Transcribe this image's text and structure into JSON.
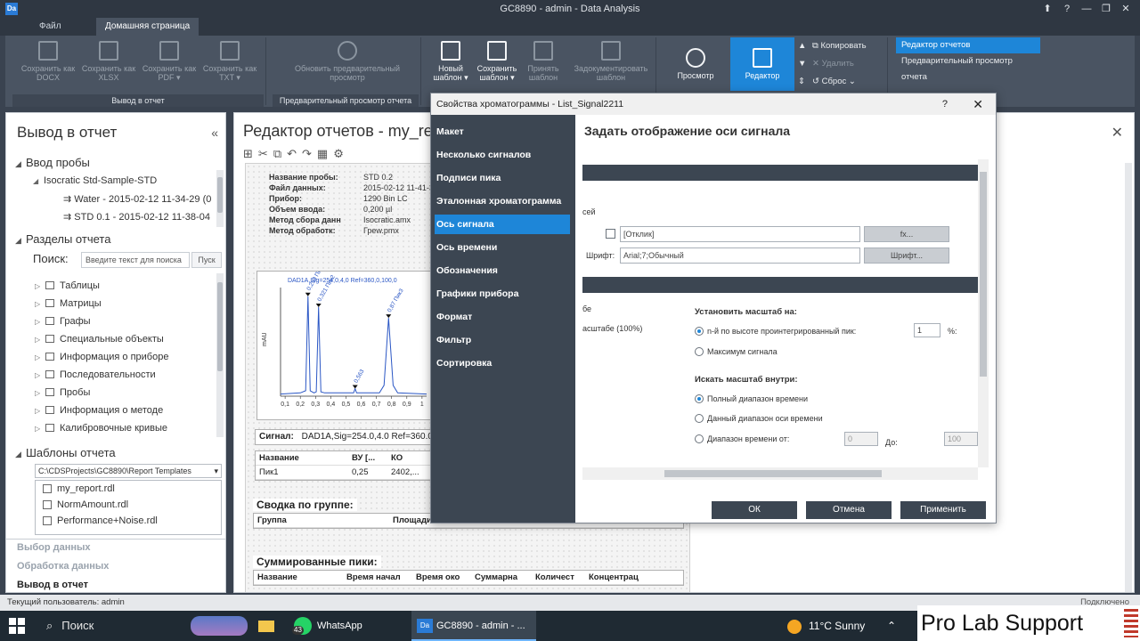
{
  "window": {
    "title": "GC8890 - admin - Data Analysis",
    "app_icon": "Da"
  },
  "ribbon": {
    "tabs": [
      {
        "label": "Файл"
      },
      {
        "label": "Домашняя страница"
      }
    ],
    "groups": {
      "output": "Вывод в отчет",
      "preview": "Предварительный просмотр отчета"
    },
    "buttons": {
      "save_docx": "Сохранить как DOCX",
      "save_xlsx": "Сохранить как XLSX",
      "save_pdf": "Сохранить как PDF ▾",
      "save_txt": "Сохранить как TXT ▾",
      "refresh_preview": "Обновить предварительный просмотр",
      "new_template": "Новый шаблон ▾",
      "save_template": "Сохранить шаблон ▾",
      "accept_template": "Принять шаблон",
      "document_template": "Задокументировать шаблон",
      "view": "Просмотр",
      "editor": "Редактор",
      "copy": "Копировать",
      "delete": "Удалить",
      "reset": "Сброс"
    },
    "report_modes": [
      "Редактор отчетов",
      "Предварительный просмотр отчета"
    ]
  },
  "left_panel": {
    "title": "Вывод в отчет",
    "sample_section": "Ввод пробы",
    "sample_tree": [
      "Isocratic Std-Sample-STD",
      "Water - 2015-02-12 11-34-29 (0",
      "STD 0.1 - 2015-02-12 11-38-04"
    ],
    "sections_title": "Разделы отчета",
    "search_label": "Поиск:",
    "search_placeholder": "Введите текст для поиска",
    "search_button": "Пуск",
    "sections": [
      "Таблицы",
      "Матрицы",
      "Графы",
      "Специальные объекты",
      "Информация о приборе",
      "Последовательности",
      "Пробы",
      "Информация о методе",
      "Калибровочные кривые"
    ],
    "templates_title": "Шаблоны отчета",
    "templates_path": "C:\\CDSProjects\\GC8890\\Report Templates",
    "templates": [
      "my_report.rdl",
      "NormAmount.rdl",
      "Performance+Noise.rdl"
    ],
    "nav": [
      "Выбор данных",
      "Обработка данных",
      "Вывод в отчет"
    ]
  },
  "editor": {
    "title": "Редактор отчетов - my_re",
    "sample_info": [
      {
        "k": "Название пробы:",
        "v": "STD 0.2"
      },
      {
        "k": "Файл данных:",
        "v": "2015-02-12 11-41-39"
      },
      {
        "k": "Прибор:",
        "v": "1290 Bin LC"
      },
      {
        "k": "Объем ввода:",
        "v": "0,200 µl"
      },
      {
        "k": "Метод сбора данн",
        "v": "Isocratic.amx"
      },
      {
        "k": "Метод обработк:",
        "v": "Греw.pmx"
      }
    ],
    "signal_label": "Сигнал:",
    "signal_value": "DAD1A,Sig=254.0,4.0  Ref=360.0",
    "peak_table": {
      "headers": [
        "Название",
        "ВУ [...",
        "КО"
      ],
      "rows": [
        [
          "Пик1",
          "0,25",
          "2402,..."
        ]
      ]
    },
    "group_summary_title": "Сводка по группе:",
    "group_headers": [
      "Группа",
      "Площади"
    ],
    "summed_title": "Суммированные пики:",
    "summed_headers": [
      "Название",
      "Время начал",
      "Время око",
      "Суммарна",
      "Количест",
      "Концентрац"
    ]
  },
  "chart_data": {
    "type": "line",
    "title": "DAD1A,Sig=254,0,4,0  Ref=360,0,100,0",
    "ylabel": "mAU",
    "xlabel": "",
    "x_ticks": [
      0.1,
      0.2,
      0.3,
      0.4,
      0.5,
      0.6,
      0.7,
      0.8,
      0.9,
      1.0
    ],
    "x_tick_labels": [
      "0,1",
      "0,2",
      "0,3",
      "0,4",
      "0,5",
      "0,6",
      "0,7",
      "0,8",
      "0,9",
      "1"
    ],
    "xlim": [
      0.07,
      1.03
    ],
    "ylim": [
      0,
      100
    ],
    "series": [
      {
        "values": [
          [
            0.07,
            2
          ],
          [
            0.2,
            3
          ],
          [
            0.235,
            5
          ],
          [
            0.25,
            92
          ],
          [
            0.265,
            5
          ],
          [
            0.29,
            3
          ],
          [
            0.305,
            4
          ],
          [
            0.32,
            82
          ],
          [
            0.335,
            4
          ],
          [
            0.36,
            3
          ],
          [
            0.55,
            3
          ],
          [
            0.56,
            7
          ],
          [
            0.57,
            3
          ],
          [
            0.72,
            3
          ],
          [
            0.75,
            10
          ],
          [
            0.78,
            72
          ],
          [
            0.81,
            10
          ],
          [
            0.84,
            3
          ],
          [
            1.03,
            2
          ]
        ]
      }
    ],
    "peak_labels": [
      {
        "x": 0.25,
        "y": 92,
        "text": "0,253 Пик1"
      },
      {
        "x": 0.32,
        "y": 82,
        "text": "0,321 Пик2"
      },
      {
        "x": 0.56,
        "y": 7,
        "text": "0,563"
      },
      {
        "x": 0.78,
        "y": 72,
        "text": "0,87 Пик3"
      }
    ]
  },
  "dialog": {
    "title": "Свойства хроматограммы - List_Signal2211",
    "help": "?",
    "close": "✕",
    "nav": [
      "Макет",
      "Несколько сигналов",
      "Подписи пика",
      "Эталонная хроматограмма",
      "Ось сигнала",
      "Ось времени",
      "Обозначения",
      "Графики прибора",
      "Формат",
      "Фильтр",
      "Сортировка"
    ],
    "heading": "Задать отображение оси сигнала",
    "axis_cut_label": "сей",
    "response_value": "[Отклик]",
    "fx_button": "fx...",
    "font_label": "Шрифт:",
    "font_value": "Arial;7;Обычный",
    "font_button": "Шрифт...",
    "left_cut_1": "бе",
    "left_cut_2": "асштабе (100%)",
    "scale_title": "Установить масштаб на:",
    "scale_opt1": "n-й по высоте проинтегрированный пик:",
    "scale_n": "1",
    "scale_unit": "%:",
    "scale_opt2": "Максимум сигнала",
    "search_title": "Искать масштаб внутри:",
    "range_opt1": "Полный диапазон времени",
    "range_opt2": "Данный диапазон оси времени",
    "range_opt3": "Диапазон времени от:",
    "range_from": "0",
    "range_to_label": "До:",
    "range_to": "100",
    "ok": "ОК",
    "cancel": "Отмена",
    "apply": "Применить"
  },
  "status": {
    "user": "Текущий пользователь: admin",
    "connection": "Подключено"
  },
  "taskbar": {
    "search": "Поиск",
    "whatsapp": "WhatsApp",
    "whatsapp_badge": "43",
    "active_app": "GC8890 - admin - ...",
    "weather": "11°C  Sunny"
  },
  "watermark": "Pro Lab Support"
}
